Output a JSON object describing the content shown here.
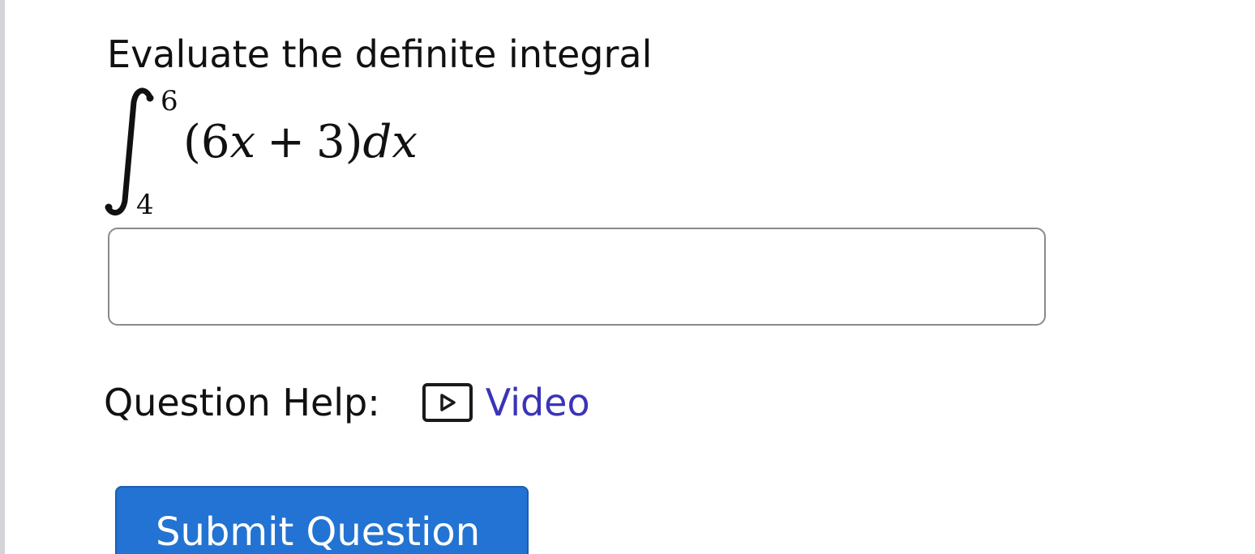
{
  "question": {
    "prompt": "Evaluate the definite integral",
    "integral": {
      "upper_limit": "6",
      "lower_limit": "4",
      "open_paren": "(",
      "coefficient": "6",
      "variable": "x",
      "operator": "+",
      "constant": "3",
      "close_paren": ")",
      "differential": "dx"
    },
    "answer_value": "",
    "answer_placeholder": ""
  },
  "help": {
    "label": "Question Help:",
    "video_icon": "play-video-icon",
    "video_label": "Video"
  },
  "actions": {
    "submit_label": "Submit Question"
  },
  "colors": {
    "link": "#3a34b8",
    "submit_background": "#2273d3",
    "input_border": "#8a8a8a"
  }
}
